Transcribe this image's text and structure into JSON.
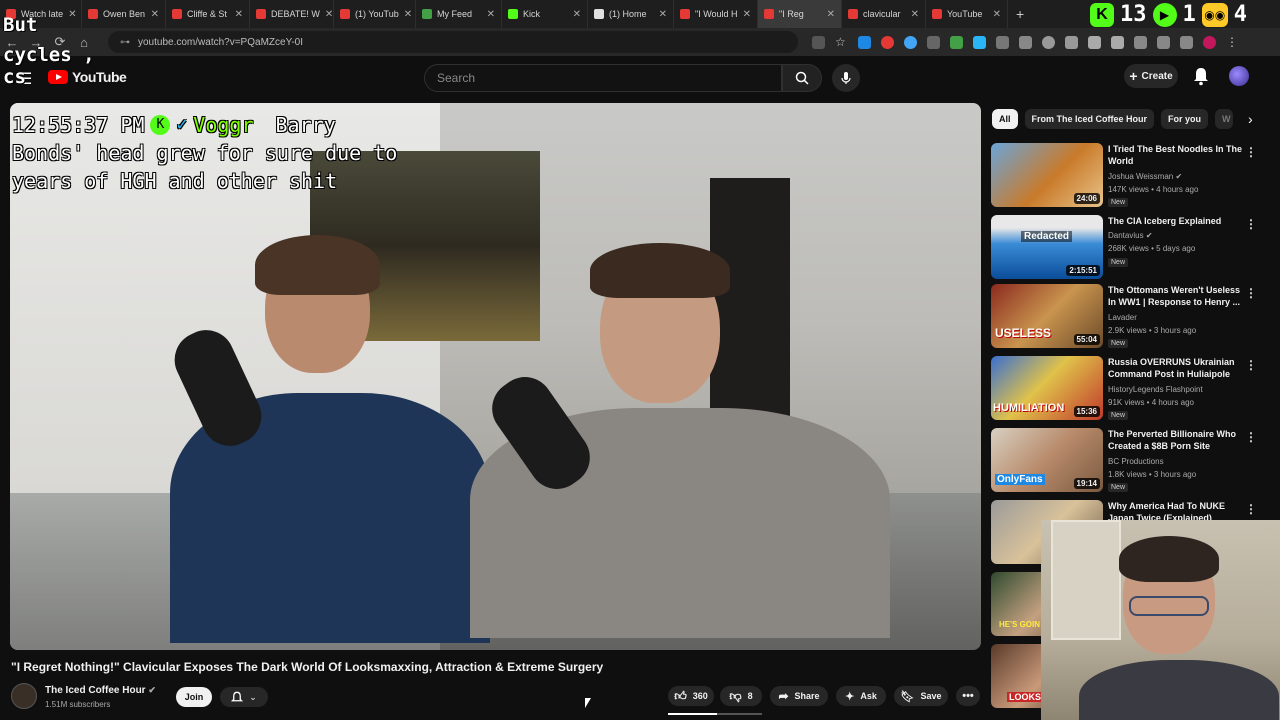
{
  "browser": {
    "tabs": [
      {
        "label": "Watch late",
        "color": "#e53935"
      },
      {
        "label": "Owen Ben",
        "color": "#e53935"
      },
      {
        "label": "Cliffe & St",
        "color": "#e53935"
      },
      {
        "label": "DEBATE! W",
        "color": "#e53935"
      },
      {
        "label": "(1) YouTub",
        "color": "#e53935"
      },
      {
        "label": "My Feed",
        "color": "#43a047"
      },
      {
        "label": "Kick",
        "color": "#53fc18"
      },
      {
        "label": "(1) Home",
        "color": "#e0e0e0"
      },
      {
        "label": "\"I Would H",
        "color": "#e53935"
      },
      {
        "label": "\"I Reg",
        "color": "#e53935"
      },
      {
        "label": "clavicular",
        "color": "#e53935"
      },
      {
        "label": "YouTube",
        "color": "#e53935"
      }
    ],
    "url": "youtube.com/watch?v=PQaMZceY-0I"
  },
  "overlay": {
    "top_left_lines": [
      "But",
      "cycles ,",
      "cs"
    ],
    "top_right_count1": "13",
    "top_right_count2": "1",
    "top_right_count3": "4"
  },
  "chat_overlay": {
    "time": "12:55:37 PM",
    "user": "Voggr",
    "message_line1": "Barry",
    "message_line2": "Bonds' head grew for sure due to",
    "message_line3": "years of HGH and other shit"
  },
  "header": {
    "logo_text": "YouTube",
    "search_placeholder": "Search",
    "create_label": "Create"
  },
  "video": {
    "title": "\"I Regret Nothing!\" Clavicular Exposes The Dark World Of Looksmaxxing, Attraction & Extreme Surgery",
    "channel": "The Iced Coffee Hour",
    "subscribers": "1.51M subscribers",
    "join_label": "Join",
    "like_count": "360",
    "dislike_count": "8",
    "share_label": "Share",
    "ask_label": "Ask",
    "save_label": "Save"
  },
  "chips": [
    "All",
    "From The Iced Coffee Hour",
    "For you",
    "W"
  ],
  "recommendations": [
    {
      "title": "I Tried The Best Noodles In The World",
      "channel": "Joshua Weissman",
      "meta": "147K views • 4 hours ago",
      "badge": "New",
      "duration": "24:06"
    },
    {
      "title": "The CIA Iceberg Explained",
      "channel": "Dantavius",
      "meta": "268K views • 5 days ago",
      "badge": "New",
      "duration": "2:15:51"
    },
    {
      "title": "The Ottomans Weren't Useless In WW1 | Response to Henry ...",
      "channel": "Lavader",
      "meta": "2.9K views • 3 hours ago",
      "badge": "New",
      "duration": "55:04"
    },
    {
      "title": "Russia OVERRUNS Ukrainian Command Post in Huliaipole",
      "channel": "HistoryLegends Flashpoint",
      "meta": "91K views • 4 hours ago",
      "badge": "New",
      "duration": "15:36"
    },
    {
      "title": "The Perverted Billionaire Who Created a $8B Porn Site",
      "channel": "BC Productions",
      "meta": "1.8K views • 3 hours ago",
      "badge": "New",
      "duration": "19:14"
    },
    {
      "title": "Why America Had To NUKE Japan Twice (Explained)",
      "channel": "",
      "meta": "",
      "badge": "",
      "duration": ""
    }
  ],
  "thumb_captions": {
    "t2": "Redacted",
    "t3": "USELESS",
    "t4": "HUMILIATION",
    "t5": "OnlyFans",
    "t7": "HE'S GOIN",
    "t8": "LOOKS"
  }
}
